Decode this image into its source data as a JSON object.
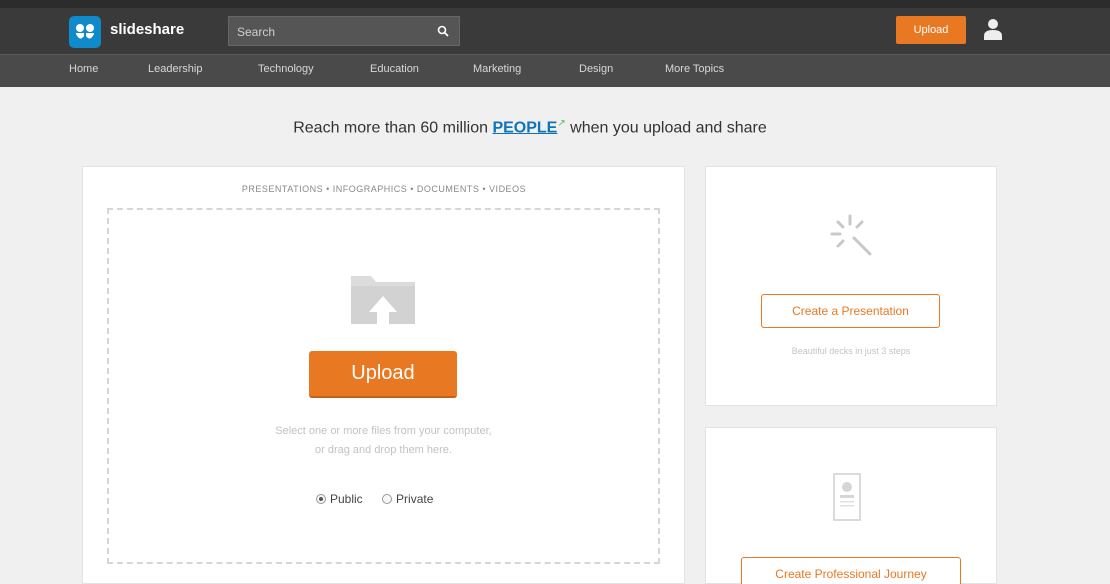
{
  "header": {
    "logo_text": "slideshare",
    "search_placeholder": "Search",
    "upload_label": "Upload"
  },
  "nav": {
    "items": [
      "Home",
      "Leadership",
      "Technology",
      "Education",
      "Marketing",
      "Design",
      "More Topics"
    ]
  },
  "headline": {
    "before": "Reach more than 60 million ",
    "people": "PEOPLE",
    "after": " when you upload and share"
  },
  "upload_panel": {
    "types": "PRESENTATIONS • INFOGRAPHICS • DOCUMENTS • VIDEOS",
    "button_label": "Upload",
    "hint_line1": "Select one or more files from your computer,",
    "hint_line2": "or drag and drop them here.",
    "privacy_options": [
      "Public",
      "Private"
    ],
    "privacy_selected": "Public"
  },
  "side": {
    "create_presentation_label": "Create a Presentation",
    "create_presentation_sub": "Beautiful decks in just 3 steps",
    "create_journey_label": "Create Professional Journey"
  },
  "colors": {
    "accent": "#e87822",
    "link": "#0e73b8",
    "topbar": "#3a3a3a",
    "navbar": "#4a4a4a"
  }
}
